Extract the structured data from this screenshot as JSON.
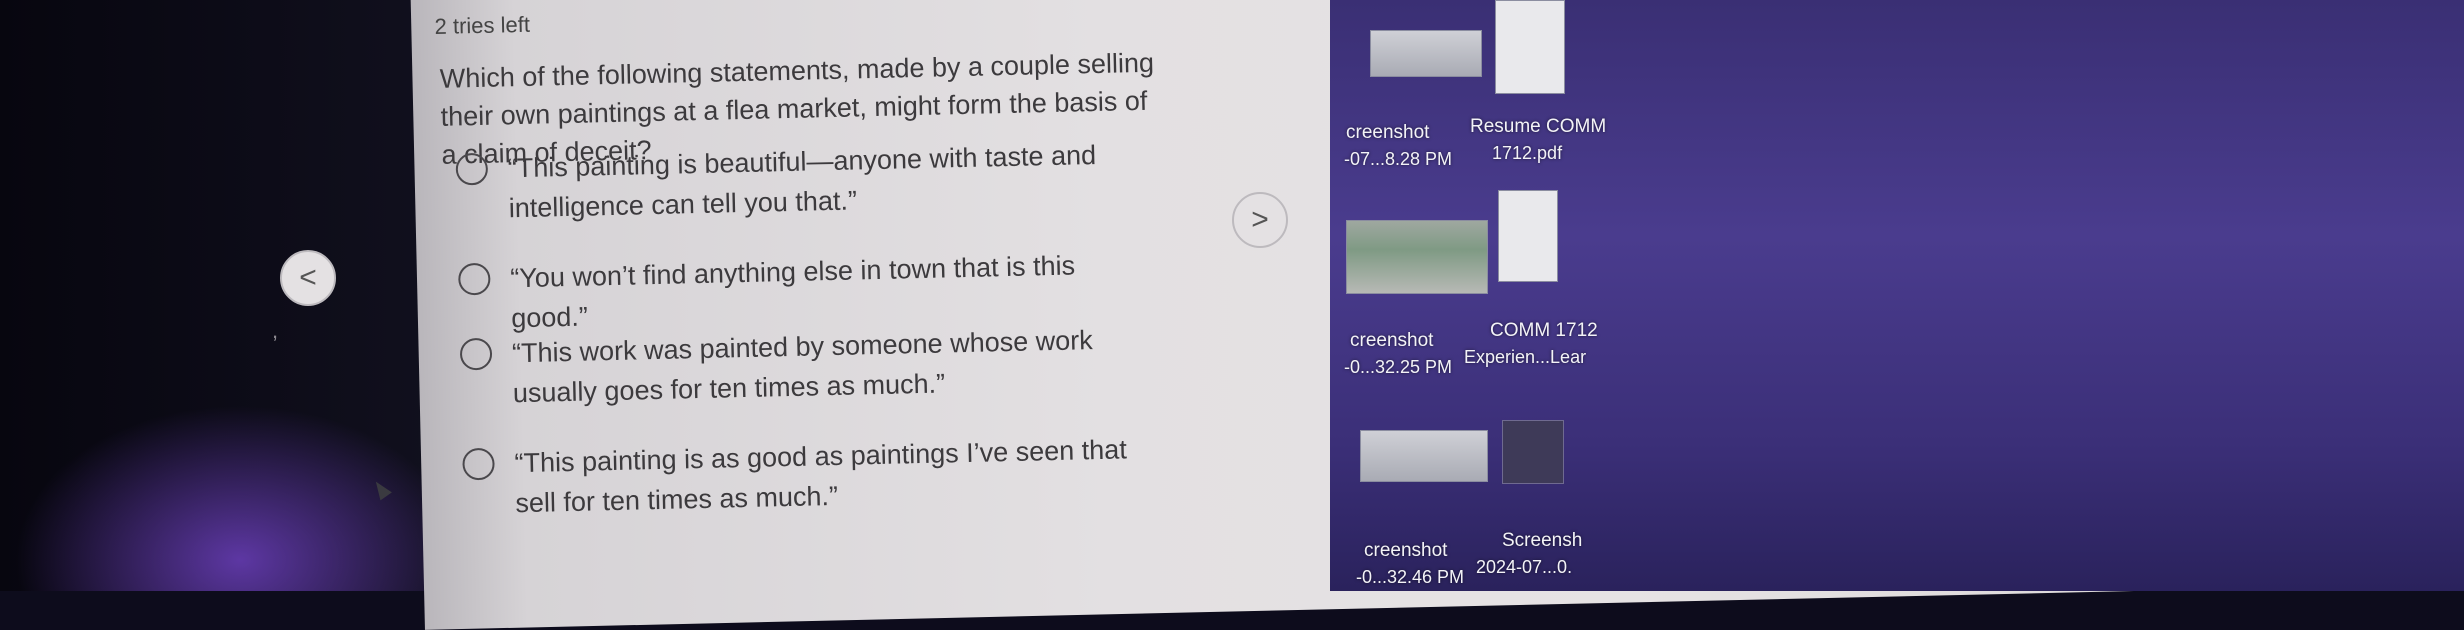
{
  "quiz": {
    "tries_left": "2 tries left",
    "question": "Which of the following statements, made by a couple selling their own paintings at a flea market, might form the basis of a claim of deceit?",
    "options": [
      {
        "text": "“This painting is beautiful—anyone with taste and intelligence can tell you that.”"
      },
      {
        "text": "“You won’t find anything else in town that is this good.”"
      },
      {
        "text": "“This work was painted by someone whose work usually goes for ten times as much.”"
      },
      {
        "text": "“This painting is as good as paintings I’ve seen that sell for ten times as much.”"
      }
    ],
    "nav_prev": "<",
    "nav_next": ">"
  },
  "desktop": {
    "icons": [
      {
        "line1": "creenshot",
        "line2": "-07...8.28 PM"
      },
      {
        "line1": "Resume COMM",
        "line2": "1712.pdf"
      },
      {
        "line1": "creenshot",
        "line2": "-0...32.25 PM"
      },
      {
        "line1": "COMM 1712",
        "line2": "Experien...Lear"
      },
      {
        "line1": "creenshot",
        "line2": "-0...32.46 PM"
      },
      {
        "line1": "Screensh",
        "line2": "2024-07...0."
      }
    ]
  },
  "colors": {
    "panel": "#e3e0e2",
    "text": "#3c3a3d",
    "desktop": "#4a3c8e"
  },
  "icon_names": [
    "radio-icon",
    "chevron-left-icon",
    "chevron-right-icon",
    "cursor-icon",
    "document-icon"
  ]
}
